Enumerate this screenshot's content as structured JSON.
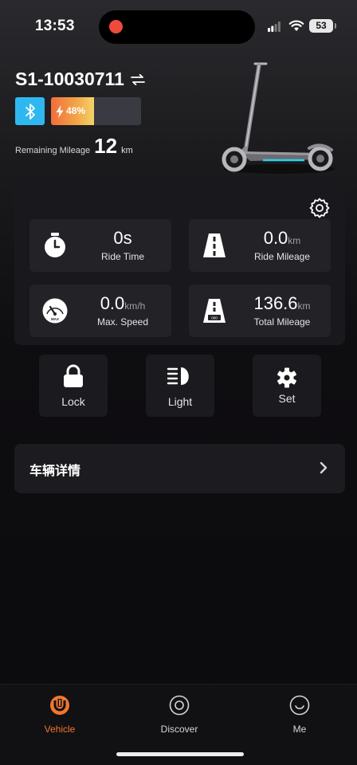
{
  "status_bar": {
    "time": "13:53",
    "battery": "53"
  },
  "vehicle": {
    "id": "S1-10030711",
    "battery_percent": 48,
    "battery_label": "48%",
    "remaining_label": "Remaining Mileage",
    "remaining_value": "12",
    "remaining_unit": "km"
  },
  "stats": {
    "ride_time": {
      "value": "0s",
      "unit": "",
      "label": "Ride Time",
      "icon": "stopwatch-icon"
    },
    "ride_mileage": {
      "value": "0.0",
      "unit": "km",
      "label": "Ride Mileage",
      "icon": "road-icon"
    },
    "max_speed": {
      "value": "0.0",
      "unit": "km/h",
      "label": "Max. Speed",
      "icon": "speedometer-icon"
    },
    "total_mileage": {
      "value": "136.6",
      "unit": "km",
      "label": "Total Mileage",
      "icon": "odometer-road-icon"
    }
  },
  "controls": {
    "lock": {
      "label": "Lock",
      "icon": "lock-icon"
    },
    "light": {
      "label": "Light",
      "icon": "headlight-icon"
    },
    "set": {
      "label": "Set",
      "icon": "gear-icon"
    }
  },
  "details": {
    "label": "车辆详情"
  },
  "tabs": [
    {
      "label": "Vehicle",
      "icon": "vehicle-logo-icon",
      "active": true
    },
    {
      "label": "Discover",
      "icon": "discover-icon",
      "active": false
    },
    {
      "label": "Me",
      "icon": "smiley-icon",
      "active": false
    }
  ],
  "colors": {
    "accent": "#f2762e",
    "bluetooth": "#2fb8f0",
    "battery_start": "#f26d3a",
    "battery_end": "#f5d36a"
  }
}
